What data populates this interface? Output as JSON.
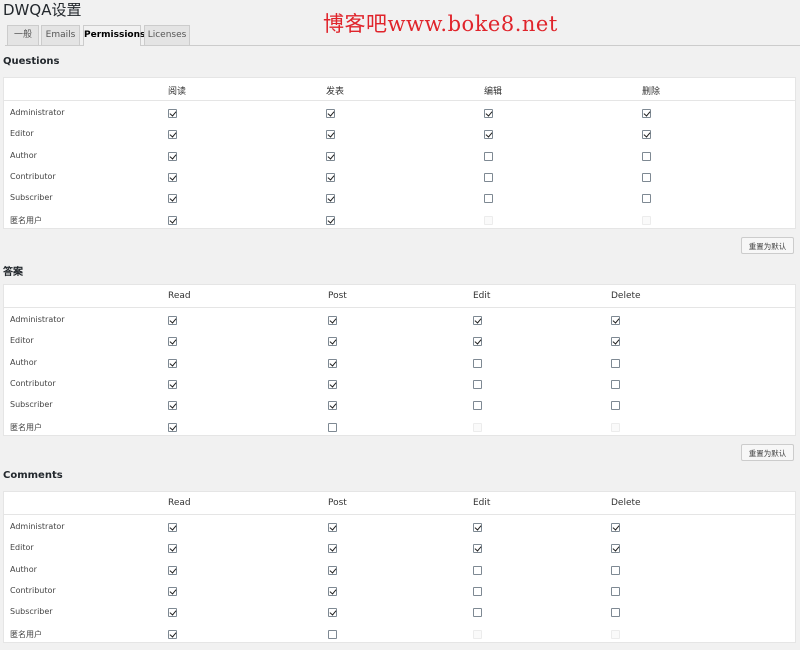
{
  "page_title": "DWQA设置",
  "watermark": "博客吧www.boke8.net",
  "tabs": [
    {
      "label": "一般"
    },
    {
      "label": "Emails"
    },
    {
      "label": "Permissions",
      "active": true
    },
    {
      "label": "Licenses"
    }
  ],
  "sections": [
    {
      "title": "Questions",
      "columns": [
        "阅读",
        "发表",
        "编辑",
        "删除"
      ],
      "rows": [
        {
          "role": "Administrator",
          "perms": [
            "checked",
            "checked",
            "checked",
            "checked"
          ]
        },
        {
          "role": "Editor",
          "perms": [
            "checked",
            "checked",
            "checked",
            "checked"
          ]
        },
        {
          "role": "Author",
          "perms": [
            "checked",
            "checked",
            "unchecked",
            "unchecked"
          ]
        },
        {
          "role": "Contributor",
          "perms": [
            "checked",
            "checked",
            "unchecked",
            "unchecked"
          ]
        },
        {
          "role": "Subscriber",
          "perms": [
            "checked",
            "checked",
            "unchecked",
            "unchecked"
          ]
        },
        {
          "role": "匿名用户",
          "perms": [
            "checked",
            "checked",
            "disabled",
            "disabled"
          ]
        }
      ],
      "reset_label": "重置为默认"
    },
    {
      "title": "答案",
      "columns": [
        "Read",
        "Post",
        "Edit",
        "Delete"
      ],
      "rows": [
        {
          "role": "Administrator",
          "perms": [
            "checked",
            "checked",
            "checked",
            "checked"
          ]
        },
        {
          "role": "Editor",
          "perms": [
            "checked",
            "checked",
            "checked",
            "checked"
          ]
        },
        {
          "role": "Author",
          "perms": [
            "checked",
            "checked",
            "unchecked",
            "unchecked"
          ]
        },
        {
          "role": "Contributor",
          "perms": [
            "checked",
            "checked",
            "unchecked",
            "unchecked"
          ]
        },
        {
          "role": "Subscriber",
          "perms": [
            "checked",
            "checked",
            "unchecked",
            "unchecked"
          ]
        },
        {
          "role": "匿名用户",
          "perms": [
            "checked",
            "unchecked",
            "disabled",
            "disabled"
          ]
        }
      ],
      "reset_label": "重置为默认"
    },
    {
      "title": "Comments",
      "columns": [
        "Read",
        "Post",
        "Edit",
        "Delete"
      ],
      "rows": [
        {
          "role": "Administrator",
          "perms": [
            "checked",
            "checked",
            "checked",
            "checked"
          ]
        },
        {
          "role": "Editor",
          "perms": [
            "checked",
            "checked",
            "checked",
            "checked"
          ]
        },
        {
          "role": "Author",
          "perms": [
            "checked",
            "checked",
            "unchecked",
            "unchecked"
          ]
        },
        {
          "role": "Contributor",
          "perms": [
            "checked",
            "checked",
            "unchecked",
            "unchecked"
          ]
        },
        {
          "role": "Subscriber",
          "perms": [
            "checked",
            "checked",
            "unchecked",
            "unchecked"
          ]
        },
        {
          "role": "匿名用户",
          "perms": [
            "checked",
            "unchecked",
            "disabled",
            "disabled"
          ]
        }
      ]
    }
  ]
}
